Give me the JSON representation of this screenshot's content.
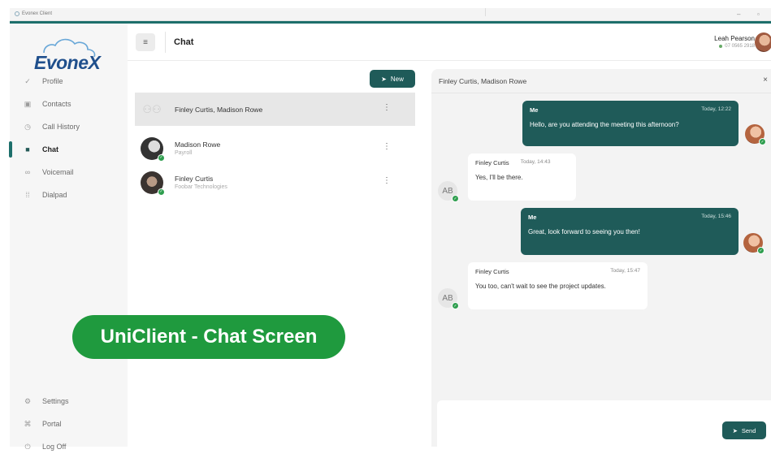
{
  "window": {
    "title": "Evonex Client",
    "minimize_glyph": "–",
    "maximize_glyph": "▫"
  },
  "brand": {
    "logo_text": "EvoneX"
  },
  "sidebar": {
    "items": [
      {
        "label": "Profile",
        "icon": "check-icon",
        "glyph": "✓",
        "active": false
      },
      {
        "label": "Contacts",
        "icon": "contacts-icon",
        "glyph": "▣",
        "active": false
      },
      {
        "label": "Call History",
        "icon": "history-icon",
        "glyph": "◷",
        "active": false
      },
      {
        "label": "Chat",
        "icon": "chat-icon",
        "glyph": "■",
        "active": true
      },
      {
        "label": "Voicemail",
        "icon": "voicemail-icon",
        "glyph": "∞",
        "active": false
      },
      {
        "label": "Dialpad",
        "icon": "dialpad-icon",
        "glyph": "⁞⁞",
        "active": false
      }
    ],
    "bottom_items": [
      {
        "label": "Settings",
        "icon": "gear-icon",
        "glyph": "⚙"
      },
      {
        "label": "Portal",
        "icon": "portal-icon",
        "glyph": "⌘"
      },
      {
        "label": "Log Off",
        "icon": "logoff-icon",
        "glyph": "⏻"
      }
    ]
  },
  "header": {
    "menu_glyph": "≡",
    "title": "Chat",
    "user_name": "Leah Pearson",
    "user_status": "07 0565 2918"
  },
  "list": {
    "new_button": "New",
    "new_glyph": "➤",
    "conversations": [
      {
        "name": "Finley Curtis, Madison Rowe",
        "subtitle": "",
        "selected": true
      },
      {
        "name": "Madison Rowe",
        "subtitle": "Payroll",
        "selected": false
      },
      {
        "name": "Finley Curtis",
        "subtitle": "Foobar Technologies",
        "selected": false
      }
    ],
    "kebab_glyph": "⋮"
  },
  "chat": {
    "title": "Finley Curtis, Madison Rowe",
    "close_glyph": "×",
    "messages": [
      {
        "sender": "Me",
        "time": "Today, 12:22",
        "text": "Hello, are you attending the meeting this afternoon?",
        "outgoing": true
      },
      {
        "sender": "Finley Curtis",
        "time": "Today, 14:43",
        "text": "Yes, I'll be there.",
        "outgoing": false,
        "avatar": "AB"
      },
      {
        "sender": "Me",
        "time": "Today, 15:46",
        "text": "Great, look forward to seeing you then!",
        "outgoing": true
      },
      {
        "sender": "Finley Curtis",
        "time": "Today, 15:47",
        "text": "You too, can't wait to see the project updates.",
        "outgoing": false,
        "avatar": "AB"
      }
    ],
    "send_button": "Send",
    "send_glyph": "➤"
  },
  "banner": {
    "text": "UniClient - Chat Screen"
  },
  "colors": {
    "accent": "#1f5b59",
    "banner": "#1f9a3e",
    "online": "#2f9e4f"
  }
}
